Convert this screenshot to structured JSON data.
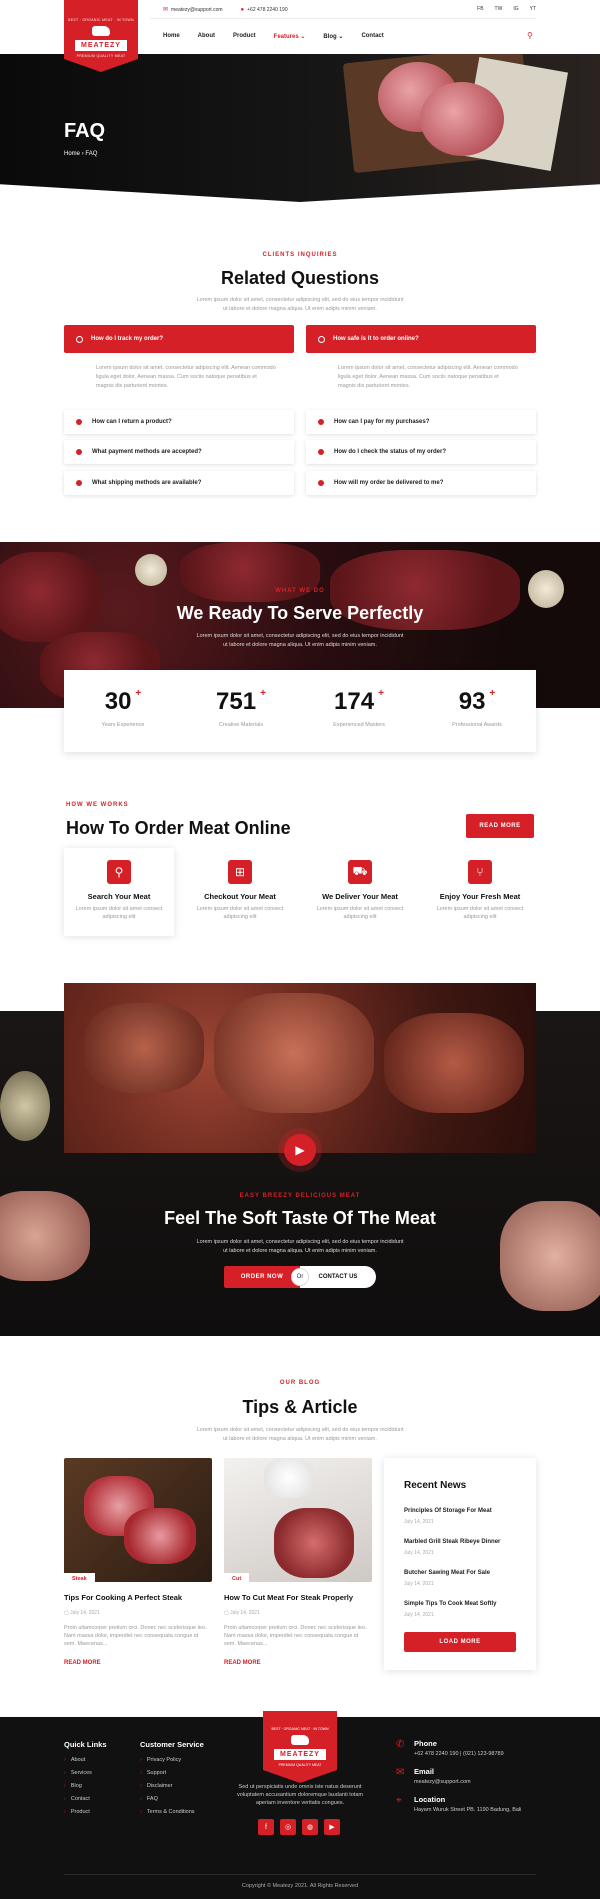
{
  "brand": {
    "name": "MEATEZY",
    "tagline_top": "BEST · ORGANIC MEAT · IN TOWN",
    "tagline_bottom": "PREMIUM QUALITY MEAT"
  },
  "topbar": {
    "email": "meatezy@support.com",
    "phone": "+62 478 2240 190",
    "social": [
      "FB",
      "TW",
      "IG",
      "YT"
    ]
  },
  "nav": {
    "items": [
      "Home",
      "About",
      "Product",
      "Features",
      "Blog",
      "Contact"
    ],
    "active": "Features"
  },
  "hero": {
    "title": "FAQ",
    "breadcrumb_home": "Home",
    "breadcrumb_current": "FAQ"
  },
  "faq": {
    "kicker": "CLIENTS INQUIRIES",
    "title": "Related Questions",
    "subtitle_1": "Lorem ipsum dolor sit amet, consectetur adipiscing elit, sed do eius tempor incididunt",
    "subtitle_2": "ut labore et dolore magna aliqua. Ut enim adipis minim veniam.",
    "open_left": {
      "question": "How do I track my order?",
      "answer": "Lorem ipsum dolor sit amet, consectetur adipiscing elit. Aenean commodo ligula eget dolor. Aenean massa. Cum sociis natoque penatibus et magnis dis parturient montes."
    },
    "open_right": {
      "question": "How safe is it to order online?",
      "answer": "Lorem ipsum dolor sit amet, consectetur adipiscing elit. Aenean commodo ligula eget dolor. Aenean massa. Cum sociis natoque penatibus et magnis dis parturient montes."
    },
    "left_items": [
      "How can I return a product?",
      "What payment methods are accepted?",
      "What shipping methods are available?"
    ],
    "right_items": [
      "How can I pay for my purchases?",
      "How do I check the status of my order?",
      "How will my order be delivered to me?"
    ]
  },
  "serve": {
    "kicker": "WHAT WE DO",
    "title": "We Ready To Serve Perfectly",
    "subtitle_1": "Lorem ipsum dolor sit amet, consectetur adipiscing elit, sed do eius tempor incididunt",
    "subtitle_2": "ut labore et dolore magna aliqua. Ut enim adipis minim veniam.",
    "stats": [
      {
        "value": "30",
        "label": "Years Experience"
      },
      {
        "value": "751",
        "label": "Creative Materials"
      },
      {
        "value": "174",
        "label": "Experienced Masters"
      },
      {
        "value": "93",
        "label": "Professional Awards"
      }
    ],
    "plus": "+"
  },
  "how": {
    "kicker": "HOW WE WORKS",
    "title": "How To Order Meat Online",
    "button": "READ MORE",
    "steps": [
      {
        "title": "Search Your Meat",
        "desc": "Lorem ipsum dolor sit amet consect adipiscing elit"
      },
      {
        "title": "Checkout Your Meat",
        "desc": "Lorem ipsum dolor sit amet consect adipiscing elit"
      },
      {
        "title": "We Deliver Your Meat",
        "desc": "Lorem ipsum dolor sit amet consect adipiscing elit"
      },
      {
        "title": "Enjoy Your Fresh Meat",
        "desc": "Lorem ipsum dolor sit amet consect adipiscing elit"
      }
    ]
  },
  "taste": {
    "kicker": "EASY BREEZY DELICIOUS MEAT",
    "title": "Feel The Soft Taste Of The Meat",
    "subtitle_1": "Lorem ipsum dolor sit amet, consectetur adipiscing elit, sed do eius tempor incididunt",
    "subtitle_2": "ut labore et dolore magna aliqua. Ut enim adipis minim veniam.",
    "order_button": "ORDER NOW",
    "or": "Or",
    "contact_button": "CONTACT US"
  },
  "blog": {
    "kicker": "OUR BLOG",
    "title": "Tips & Article",
    "subtitle_1": "Lorem ipsum dolor sit amet, consectetur adipiscing elit, sed do eius tempor incididunt",
    "subtitle_2": "ut labore et dolore magna aliqua. Ut enim adipis minim veniam.",
    "posts": [
      {
        "tag": "Steak",
        "title": "Tips For Cooking A Perfect Steak",
        "date": "July 14, 2021",
        "excerpt": "Proin ullamcorper pretium orci. Donec nec scelerisque leo. Nam massa dolor, imperdiet nec consequata congue id sem. Maecenas...",
        "read": "READ MORE"
      },
      {
        "tag": "Cut",
        "title": "How To Cut Meat For Steak Properly",
        "date": "July 14, 2021",
        "excerpt": "Proin ullamcorper pretium orci. Donec nec scelerisque leo. Nam massa dolor, imperdiet nec consequata congue id sem. Maecenas...",
        "read": "READ MORE"
      }
    ],
    "recent": {
      "title": "Recent News",
      "items": [
        {
          "title": "Principles Of Storage For Meat",
          "date": "July 14, 2021"
        },
        {
          "title": "Marbled Grill Steak Ribeye Dinner",
          "date": "July 14, 2021"
        },
        {
          "title": "Butcher Sawing Meat For Sale",
          "date": "July 14, 2021"
        },
        {
          "title": "Simple Tips To Cook Meat Softly",
          "date": "July 14, 2021"
        }
      ],
      "button": "LOAD MORE"
    }
  },
  "footer": {
    "quick_title": "Quick Links",
    "quick_links": [
      "About",
      "Services",
      "Blog",
      "Contact",
      "Product"
    ],
    "service_title": "Customer Service",
    "service_links": [
      "Privacy Policy",
      "Support",
      "Disclaimer",
      "FAQ",
      "Terms & Conditions"
    ],
    "about_1": "Sed ut perspiciatis unde omnis iste natus deserunt",
    "about_2": "voluptatem accusantium doloremque laudanti totam",
    "about_3": "aperiam inventore veritatis congues.",
    "phone_title": "Phone",
    "phone_value": "+62 478 2240 190 | (021) 123-98789",
    "email_title": "Email",
    "email_value": "meatezy@support.com",
    "location_title": "Location",
    "location_value": "Hayam Wuruk Street PB. 1190 Badung, Bali",
    "copyright": "Copyright © Meatezy 2021. All Rights Reserved"
  }
}
